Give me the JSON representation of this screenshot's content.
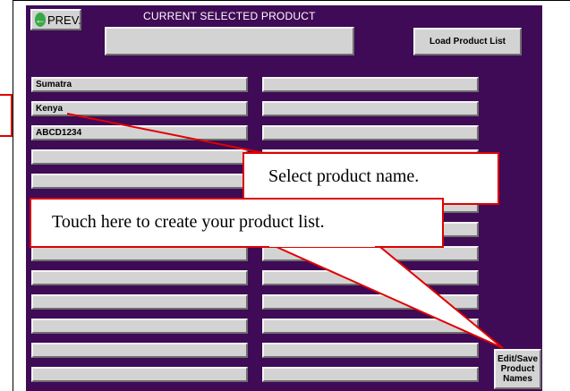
{
  "header": {
    "prev_label": "PREV.",
    "selected_title": "CURRENT SELECTED PRODUCT",
    "selected_value": "",
    "load_label": "Load Product List"
  },
  "products": {
    "left": [
      "Sumatra",
      "Kenya",
      "ABCD1234",
      "",
      "",
      "",
      "",
      "",
      "",
      "",
      "",
      "",
      ""
    ],
    "right": [
      "",
      "",
      "",
      "",
      "",
      "",
      "",
      "",
      "",
      "",
      "",
      "",
      ""
    ]
  },
  "edit_button": {
    "line1": "Edit/Save",
    "line2": "Product",
    "line3": "Names"
  },
  "callouts": {
    "select_product": "Select product name.",
    "create_list": "Touch here to create your product list."
  },
  "colors": {
    "background": "#3f0a56",
    "button_face": "#d3d3d3",
    "callout_border": "#e00000",
    "prev_icon": "#39a846"
  },
  "icons": {
    "prev": "arrow-left-icon"
  }
}
